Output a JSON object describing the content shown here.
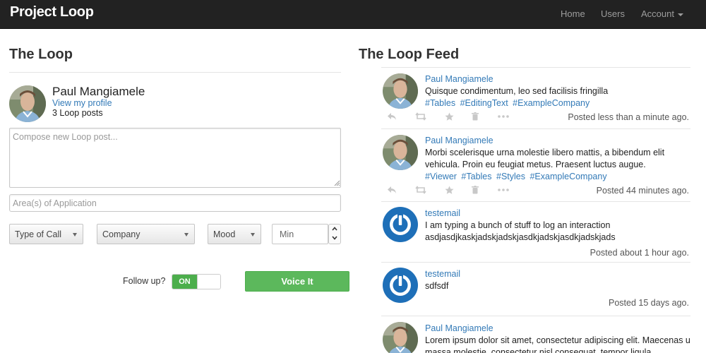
{
  "navbar": {
    "brand": "Project Loop",
    "links": [
      "Home",
      "Users"
    ],
    "account_label": "Account"
  },
  "left": {
    "title": "The Loop",
    "profile": {
      "name": "Paul Mangiamele",
      "link_label": "View my profile",
      "posts_count": "3 Loop posts"
    },
    "compose_placeholder": "Compose new Loop post...",
    "area_placeholder": "Area(s) of Application",
    "selects": {
      "type_of_call": "Type of Call",
      "company": "Company",
      "mood": "Mood"
    },
    "min_placeholder": "Min",
    "follow_up_label": "Follow up?",
    "switch_state": "ON",
    "submit_label": "Voice It"
  },
  "feed": {
    "title": "The Loop Feed",
    "items": [
      {
        "author": "Paul Mangiamele",
        "avatar": "photo",
        "lines": [
          "Quisque condimentum, leo sed facilisis fringilla"
        ],
        "tags": [
          "#Tables",
          "#EditingText",
          "#ExampleCompany"
        ],
        "time": "Posted less than a minute ago."
      },
      {
        "author": "Paul Mangiamele",
        "avatar": "photo",
        "lines": [
          "Morbi scelerisque urna molestie libero mattis, a bibendum elit",
          "vehicula. Proin eu feugiat metus. Praesent luctus augue."
        ],
        "tags": [
          "#Viewer",
          "#Tables",
          "#Styles",
          "#ExampleCompany"
        ],
        "time": "Posted 44 minutes ago."
      },
      {
        "author": "testemail",
        "avatar": "power-logo",
        "lines": [
          "I am typing a bunch of stuff to log an interaction",
          "asdjasdjkaskjadskjadskjasdkjadskjasdkjadskjads"
        ],
        "tags": [],
        "time": "Posted about 1 hour ago."
      },
      {
        "author": "testemail",
        "avatar": "power-logo",
        "lines": [
          "sdfsdf"
        ],
        "tags": [],
        "time": "Posted 15 days ago."
      },
      {
        "author": "Paul Mangiamele",
        "avatar": "photo",
        "lines": [
          "Lorem ipsum dolor sit amet, consectetur adipiscing elit. Maecenas ut",
          "massa molestie, consectetur nisl consequat, tempor ligula"
        ],
        "tags": [],
        "time": ""
      }
    ],
    "action_icons": [
      "reply-icon",
      "retweet-icon",
      "star-icon",
      "trash-icon",
      "more-icon"
    ]
  },
  "colors": {
    "navbar_bg": "#222222",
    "link": "#337ab7",
    "success": "#5cb85c",
    "logo_blue": "#1e6fb8"
  }
}
